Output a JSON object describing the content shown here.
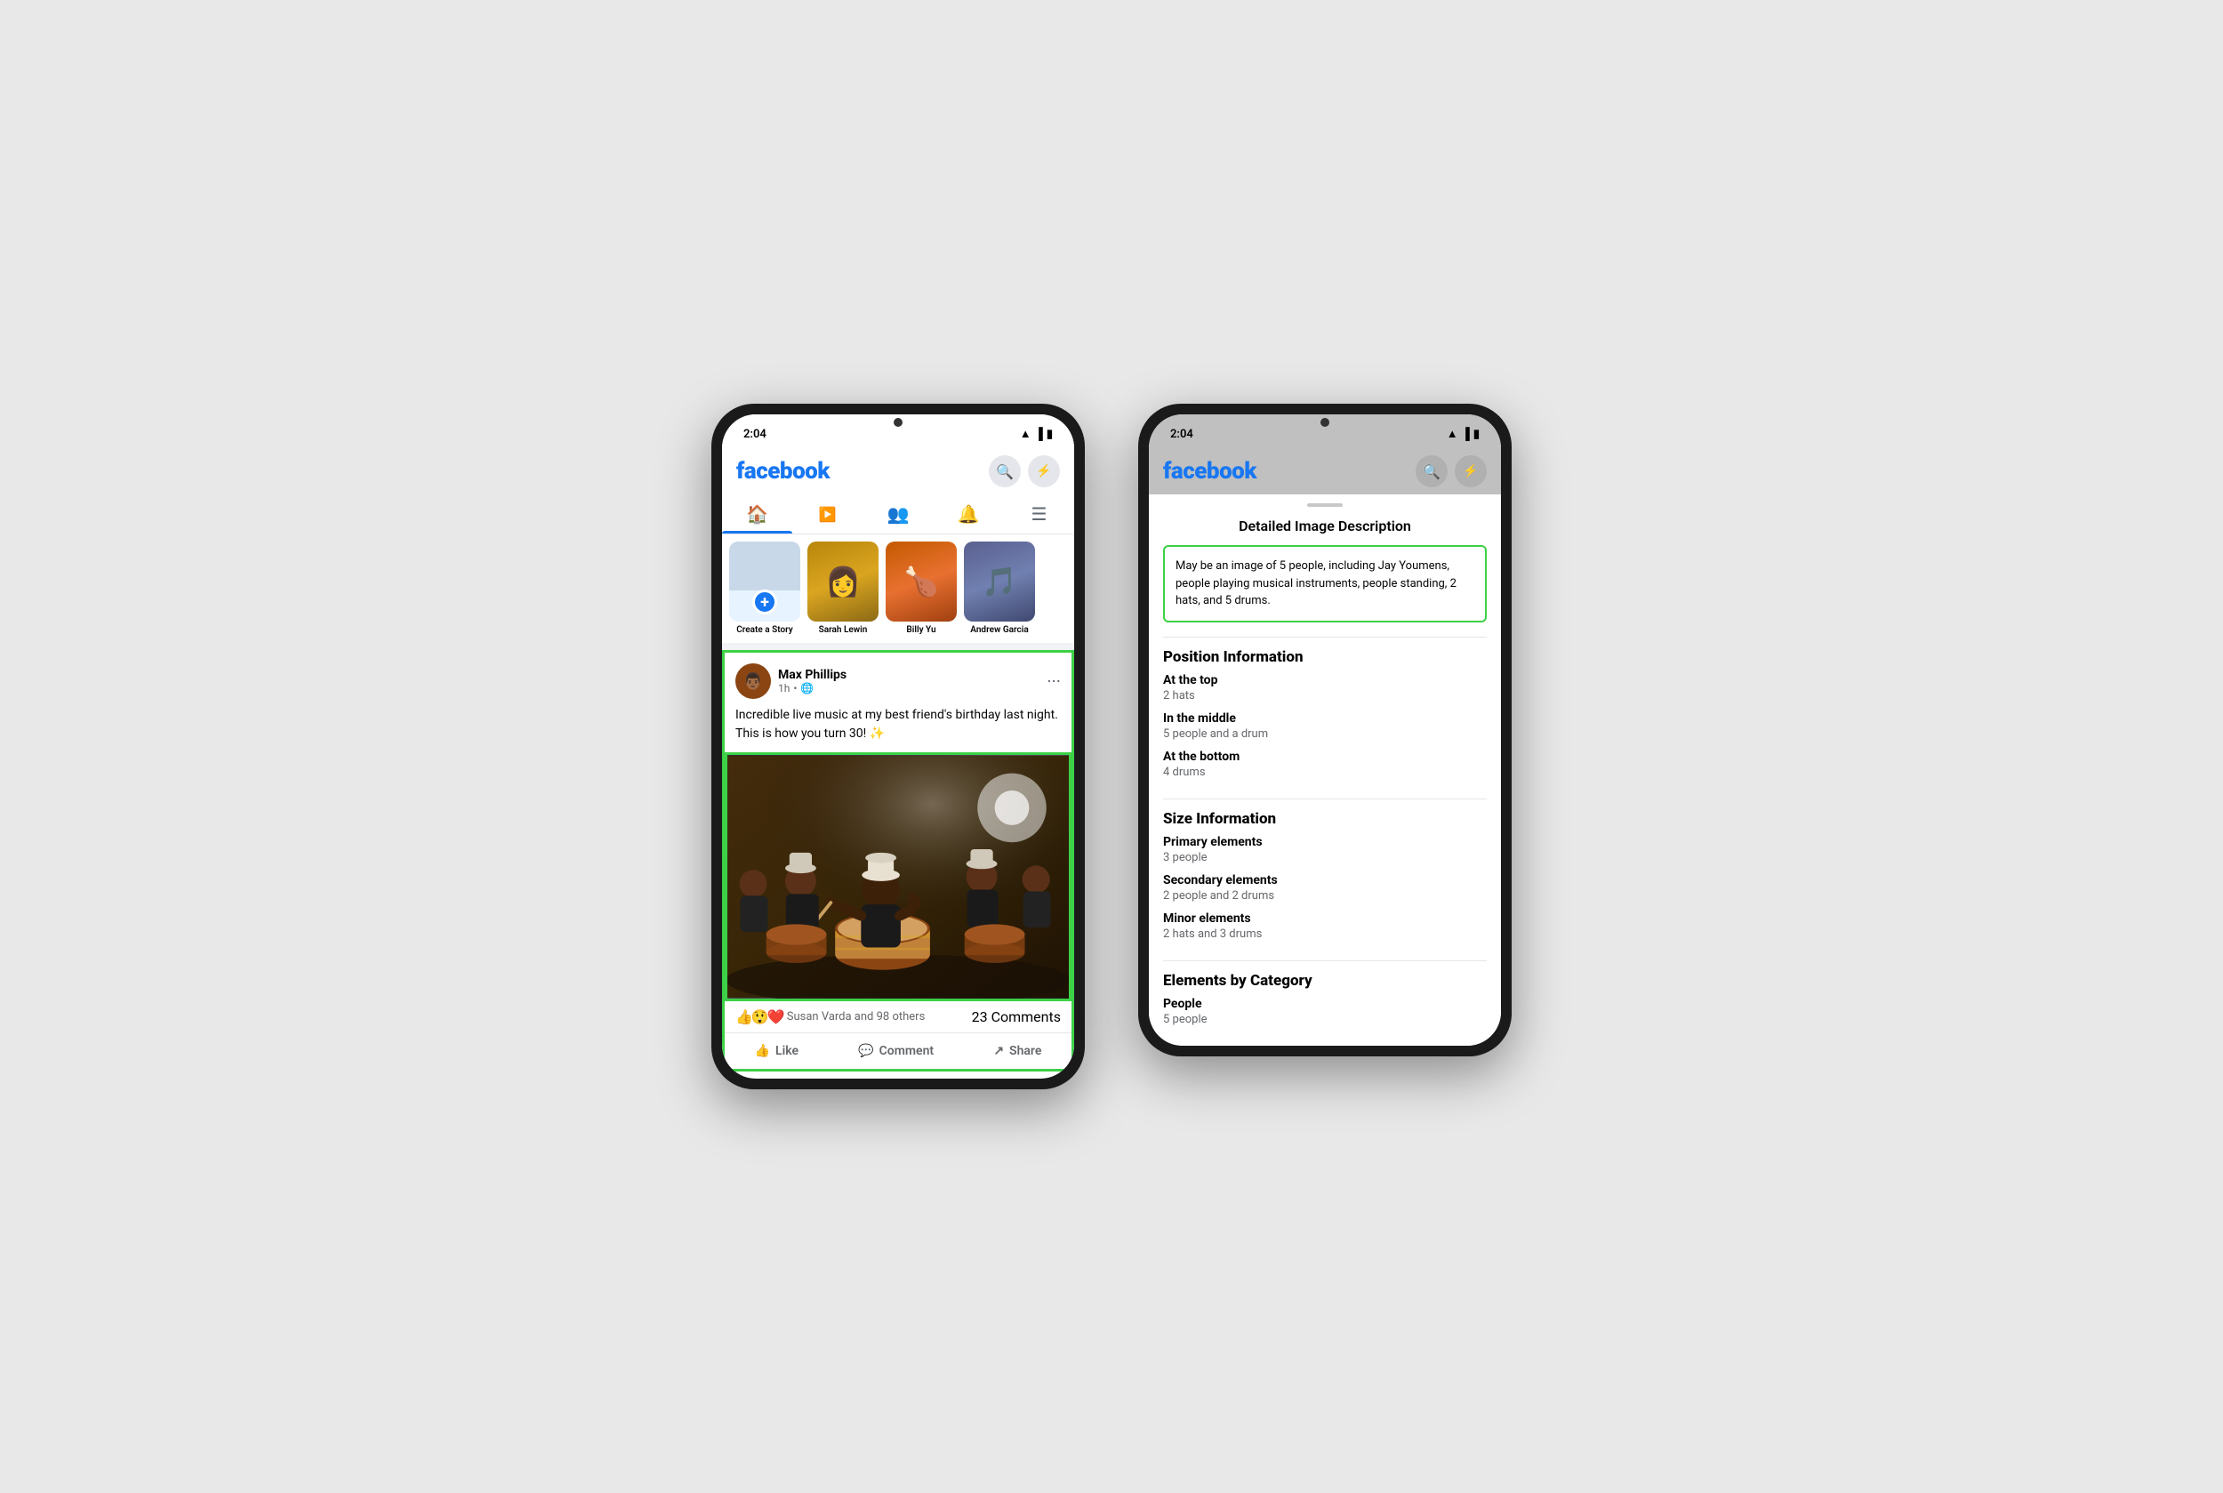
{
  "phone1": {
    "status_time": "2:04",
    "fb_logo": "facebook",
    "header_icons": {
      "search": "🔍",
      "messenger": "💬"
    },
    "nav_tabs": [
      {
        "name": "home",
        "icon": "🏠",
        "active": true
      },
      {
        "name": "video",
        "icon": "📺",
        "active": false
      },
      {
        "name": "groups",
        "icon": "👥",
        "active": false
      },
      {
        "name": "notifications",
        "icon": "🔔",
        "active": false
      },
      {
        "name": "menu",
        "icon": "☰",
        "active": false
      }
    ],
    "stories": {
      "create_label": "Create a Story",
      "items": [
        {
          "name": "Sarah Lewin",
          "bg": "sarah"
        },
        {
          "name": "Billy Yu",
          "bg": "billy"
        },
        {
          "name": "Andrew Garcia",
          "bg": "andrew"
        }
      ]
    },
    "post": {
      "author": "Max Phillips",
      "time": "1h",
      "globe": "🌐",
      "text": "Incredible live music at my best friend's birthday last night. This is how you turn 30! ✨",
      "reactions_text": "Susan Varda and 98 others",
      "comments_count": "23 Comments",
      "like_label": "Like",
      "comment_label": "Comment",
      "share_label": "Share"
    }
  },
  "phone2": {
    "status_time": "2:04",
    "fb_logo": "facebook",
    "header_icons": {
      "search": "🔍",
      "messenger": "💬"
    },
    "modal": {
      "title": "Detailed Image Description",
      "description": "May be an image of 5 people, including Jay Youmens, people playing musical instruments, people standing, 2 hats, and 5 drums.",
      "position_section": {
        "title": "Position Information",
        "items": [
          {
            "label": "At the top",
            "value": "2 hats"
          },
          {
            "label": "In the middle",
            "value": "5 people and a drum"
          },
          {
            "label": "At the bottom",
            "value": "4 drums"
          }
        ]
      },
      "size_section": {
        "title": "Size Information",
        "items": [
          {
            "label": "Primary elements",
            "value": "3 people"
          },
          {
            "label": "Secondary elements",
            "value": "2 people and 2 drums"
          },
          {
            "label": "Minor elements",
            "value": "2 hats and 3 drums"
          }
        ]
      },
      "category_section": {
        "title": "Elements by Category",
        "items": [
          {
            "label": "People",
            "value": "5 people"
          }
        ]
      }
    }
  }
}
